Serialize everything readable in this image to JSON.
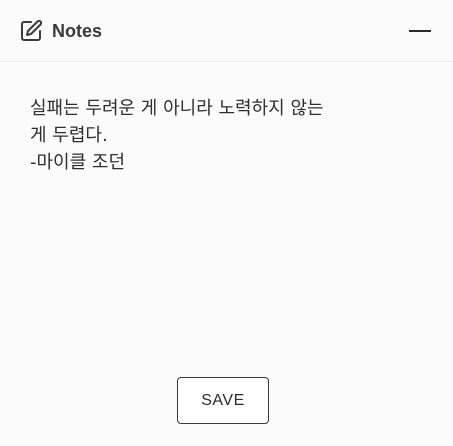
{
  "header": {
    "title": "Notes",
    "icon": "edit-note-icon",
    "minimize_icon": "minimize-icon"
  },
  "note": {
    "line1": "실패는 두려운 게 아니라 노력하지 않는",
    "line2": "게 두렵다.",
    "line3": "-마이클 조던"
  },
  "actions": {
    "save_label": "SAVE"
  },
  "colors": {
    "background": "#fbfbfb",
    "text": "#2e2e2e",
    "border": "#3a3a3a"
  }
}
